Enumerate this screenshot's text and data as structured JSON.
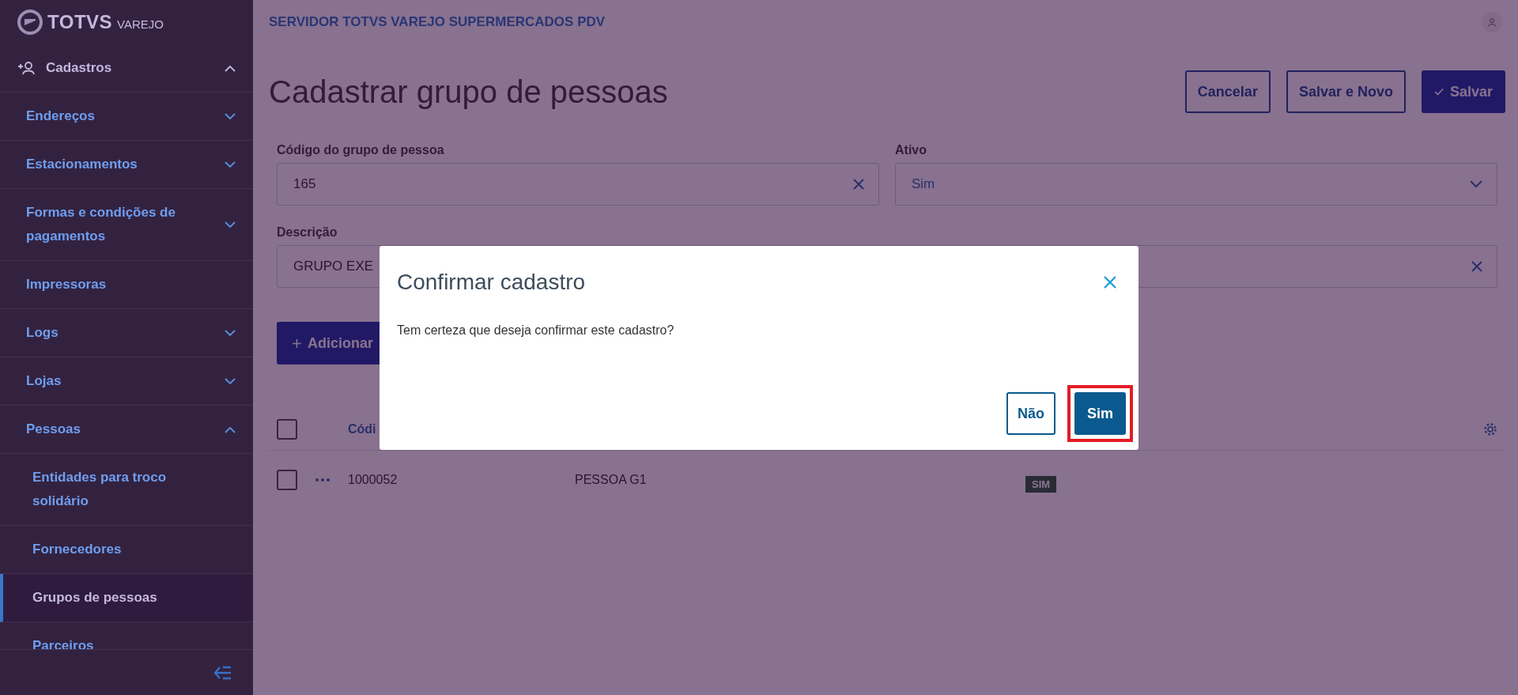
{
  "brand": {
    "name": "TOTVS",
    "product": "VAREJO"
  },
  "sidebar": {
    "items": [
      {
        "label": "Cadastros",
        "expanded": true,
        "selected": false,
        "children": [
          {
            "label": "Endereços",
            "expanded": false,
            "selected": false
          },
          {
            "label": "Estacionamentos",
            "expanded": false,
            "selected": false
          },
          {
            "label": "Formas e condições de pagamentos",
            "expanded": false,
            "selected": false
          },
          {
            "label": "Impressoras",
            "selected": false
          },
          {
            "label": "Logs",
            "expanded": false,
            "selected": false
          },
          {
            "label": "Lojas",
            "expanded": false,
            "selected": false
          },
          {
            "label": "Pessoas",
            "expanded": true,
            "selected": false,
            "children": [
              {
                "label": "Entidades para troco solidário",
                "selected": false
              },
              {
                "label": "Fornecedores",
                "selected": false
              },
              {
                "label": "Grupos de pessoas",
                "selected": true
              },
              {
                "label": "Parceiros",
                "selected": false
              }
            ]
          }
        ]
      }
    ]
  },
  "header": {
    "server": "SERVIDOR TOTVS VAREJO SUPERMERCADOS PDV"
  },
  "page": {
    "title": "Cadastrar grupo de pessoas",
    "actions": [
      {
        "label": "Cancelar",
        "kind": "outline"
      },
      {
        "label": "Salvar e Novo",
        "kind": "outline"
      },
      {
        "label": "Salvar",
        "kind": "primary"
      }
    ]
  },
  "form": {
    "fields": [
      {
        "label": "Código do grupo de pessoa",
        "value": "165",
        "kind": "text"
      },
      {
        "label": "Ativo",
        "value": "Sim",
        "kind": "select"
      },
      {
        "label": "Descrição",
        "value": "GRUPO EXE",
        "kind": "text"
      }
    ]
  },
  "add_button": {
    "label": "Adicionar"
  },
  "table": {
    "all_selected": false,
    "columns": [
      "Códi"
    ],
    "rows": [
      {
        "selected": false,
        "cells": [
          "1000052",
          "PESSOA G1"
        ],
        "badge": "SIM"
      }
    ]
  },
  "dialog": {
    "title": "Confirmar cadastro",
    "message": "Tem certeza que deseja confirmar este cadastro?",
    "buttons": [
      {
        "label": "Não",
        "kind": "outline",
        "highlighted": false
      },
      {
        "label": "Sim",
        "kind": "primary",
        "highlighted": true
      }
    ]
  }
}
